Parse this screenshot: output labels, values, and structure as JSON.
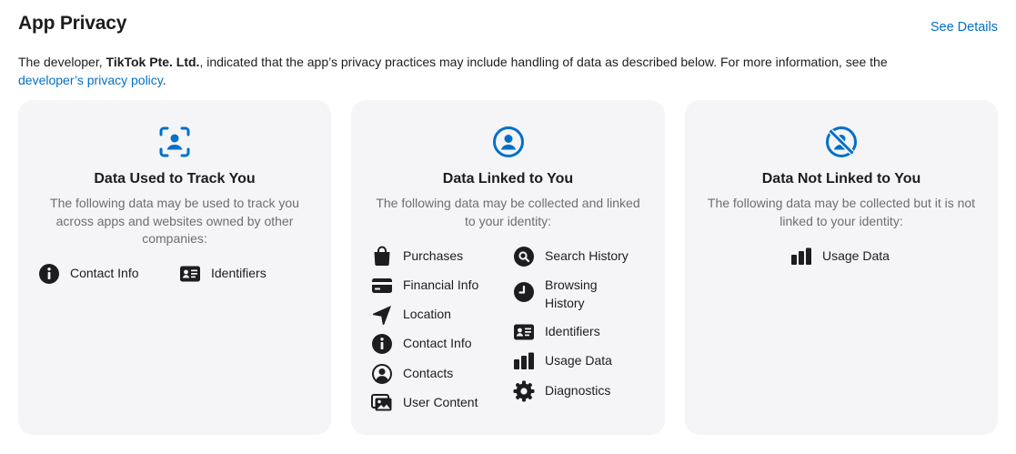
{
  "header": {
    "title": "App Privacy",
    "see_details": "See Details"
  },
  "intro": {
    "text_before": "The developer, ",
    "developer": "TikTok Pte. Ltd.",
    "text_after": ", indicated that the app’s privacy practices may include handling of data as described below. For more information, see the",
    "link": "developer’s privacy policy",
    "end": "."
  },
  "accent_color": "#0070c9",
  "cards": [
    {
      "icon": "track-user-icon",
      "title": "Data Used to Track You",
      "description": "The following data may be used to track you across apps and websites owned by other companies:",
      "items": [
        {
          "icon": "info-icon",
          "label": "Contact Info"
        },
        {
          "icon": "id-card-icon",
          "label": "Identifiers"
        }
      ]
    },
    {
      "icon": "user-circle-icon",
      "title": "Data Linked to You",
      "description": "The following data may be collected and linked to your identity:",
      "items": [
        {
          "icon": "shopping-bag-icon",
          "label": "Purchases"
        },
        {
          "icon": "credit-card-icon",
          "label": "Financial Info"
        },
        {
          "icon": "location-arrow-icon",
          "label": "Location"
        },
        {
          "icon": "info-icon",
          "label": "Contact Info"
        },
        {
          "icon": "contacts-icon",
          "label": "Contacts"
        },
        {
          "icon": "photos-icon",
          "label": "User Content"
        },
        {
          "icon": "search-icon",
          "label": "Search History"
        },
        {
          "icon": "clock-icon",
          "label": "Browsing History"
        },
        {
          "icon": "id-card-icon",
          "label": "Identifiers"
        },
        {
          "icon": "bar-chart-icon",
          "label": "Usage Data"
        },
        {
          "icon": "gear-icon",
          "label": "Diagnostics"
        }
      ]
    },
    {
      "icon": "user-not-linked-icon",
      "title": "Data Not Linked to You",
      "description": "The following data may be collected but it is not linked to your identity:",
      "items": [
        {
          "icon": "bar-chart-icon",
          "label": "Usage Data"
        }
      ]
    }
  ]
}
